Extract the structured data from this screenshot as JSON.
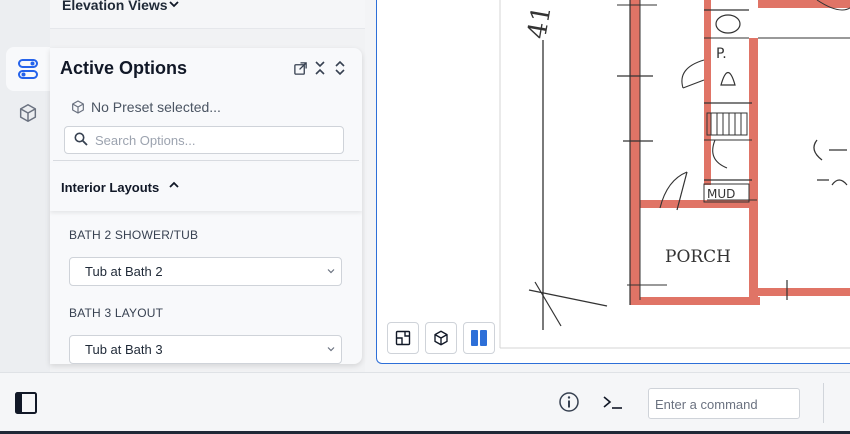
{
  "panel": {
    "elevation_views_title": "Elevation Views",
    "title": "Active Options",
    "preset_status": "No Preset selected...",
    "search_placeholder": "Search Options...",
    "section": {
      "title": "Interior Layouts",
      "options": [
        {
          "label": "BATH 2 SHOWER/TUB",
          "value": "Tub at Bath 2"
        },
        {
          "label": "BATH 3 LAYOUT",
          "value": "Tub at Bath 3"
        }
      ]
    }
  },
  "rail": {
    "items": [
      {
        "icon": "toggle-options-icon",
        "active": true
      },
      {
        "icon": "cube-icon",
        "active": false
      }
    ]
  },
  "drawing": {
    "labels": [
      "P.",
      "MUD",
      "PORCH"
    ]
  },
  "view_tools": [
    {
      "icon": "floor-plan-view-icon"
    },
    {
      "icon": "3d-view-icon"
    },
    {
      "icon": "split-view-icon",
      "active": true
    }
  ],
  "bottom_bar": {
    "command_placeholder": "Enter a command"
  },
  "colors": {
    "accent": "#2d6fd8",
    "wall_red": "#e07466"
  }
}
